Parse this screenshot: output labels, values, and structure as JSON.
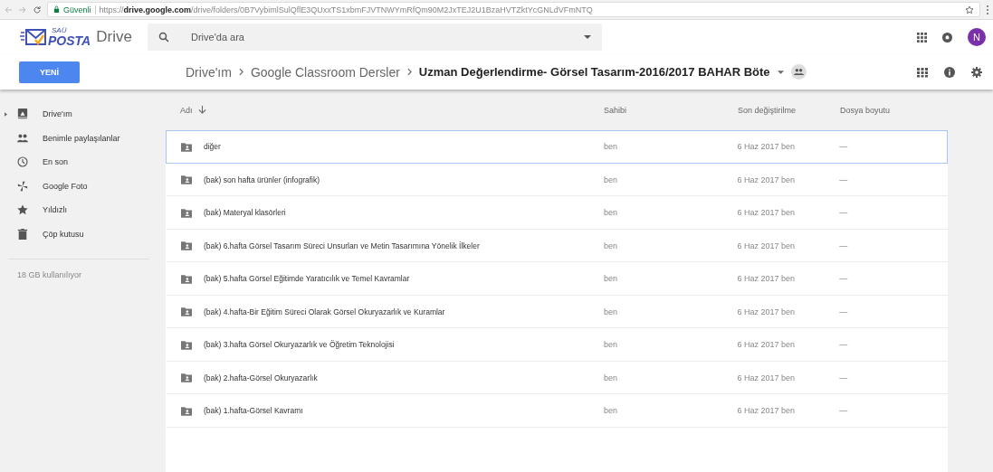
{
  "browser": {
    "security_label": "Güvenli",
    "url": "https://**drive.google.com**/drive/folders/0B7VybimlSulQflE3QUxxTS1xbmFJVTNWYmRfQm90M2JxTEJ2U1BzaHVTZktYcGNLdVFmNTQ"
  },
  "header": {
    "logo_top": "SAÜ",
    "logo_main": "POSTA",
    "product": "Drive",
    "search": {
      "placeholder": "Drive'da ara"
    },
    "avatar": "N"
  },
  "new_button": "YENİ",
  "breadcrumb": [
    {
      "label": "Drive'ım",
      "current": false
    },
    {
      "label": "Google Classroom Dersler",
      "current": false
    },
    {
      "label": "Uzman Değerlendirme- Görsel Tasarım-2016/2017 BAHAR Böte",
      "current": true
    }
  ],
  "sidebar": {
    "items": [
      {
        "label": "Drive'ım",
        "kind": "drive",
        "expandable": true
      },
      {
        "label": "Benimle paylaşılanlar",
        "kind": "shared",
        "expandable": false
      },
      {
        "label": "En son",
        "kind": "recent",
        "expandable": false
      },
      {
        "label": "Google Foto",
        "kind": "photos",
        "expandable": false
      },
      {
        "label": "Yıldızlı",
        "kind": "starred",
        "expandable": false
      },
      {
        "label": "Çöp kutusu",
        "kind": "trash",
        "expandable": false
      }
    ],
    "storage": "18 GB kullanılıyor"
  },
  "table": {
    "columns": [
      "Adı",
      "Sahibi",
      "Son değiştirilme",
      "Dosya boyutu"
    ],
    "rows": [
      {
        "name": "diğer",
        "owner": "ben",
        "modified": "6 Haz 2017 ben",
        "size": "—",
        "selected": true
      },
      {
        "name": "(bak) son hafta ürünler (infografik)",
        "owner": "ben",
        "modified": "6 Haz 2017 ben",
        "size": "—",
        "selected": false
      },
      {
        "name": "(bak) Materyal klasörleri",
        "owner": "ben",
        "modified": "6 Haz 2017 ben",
        "size": "—",
        "selected": false
      },
      {
        "name": "(bak) 6.hafta Görsel Tasarım Süreci Unsurları ve Metin Tasarımına Yönelik İlkeler",
        "owner": "ben",
        "modified": "6 Haz 2017 ben",
        "size": "—",
        "selected": false
      },
      {
        "name": "(bak) 5.hafta Görsel Eğitimde Yaratıcılık ve Temel Kavramlar",
        "owner": "ben",
        "modified": "6 Haz 2017 ben",
        "size": "—",
        "selected": false
      },
      {
        "name": "(bak) 4.hafta-Bir Eğitim Süreci Olarak Görsel Okuryazarlık ve Kuramlar",
        "owner": "ben",
        "modified": "6 Haz 2017 ben",
        "size": "—",
        "selected": false
      },
      {
        "name": "(bak) 3.hafta Görsel Okuryazarlık ve Öğretim Teknolojisi",
        "owner": "ben",
        "modified": "6 Haz 2017 ben",
        "size": "—",
        "selected": false
      },
      {
        "name": "(bak) 2.hafta-Görsel Okuryazarlık",
        "owner": "ben",
        "modified": "6 Haz 2017 ben",
        "size": "—",
        "selected": false
      },
      {
        "name": "(bak) 1.hafta-Görsel Kavramı",
        "owner": "ben",
        "modified": "6 Haz 2017 ben",
        "size": "—",
        "selected": false
      }
    ]
  }
}
